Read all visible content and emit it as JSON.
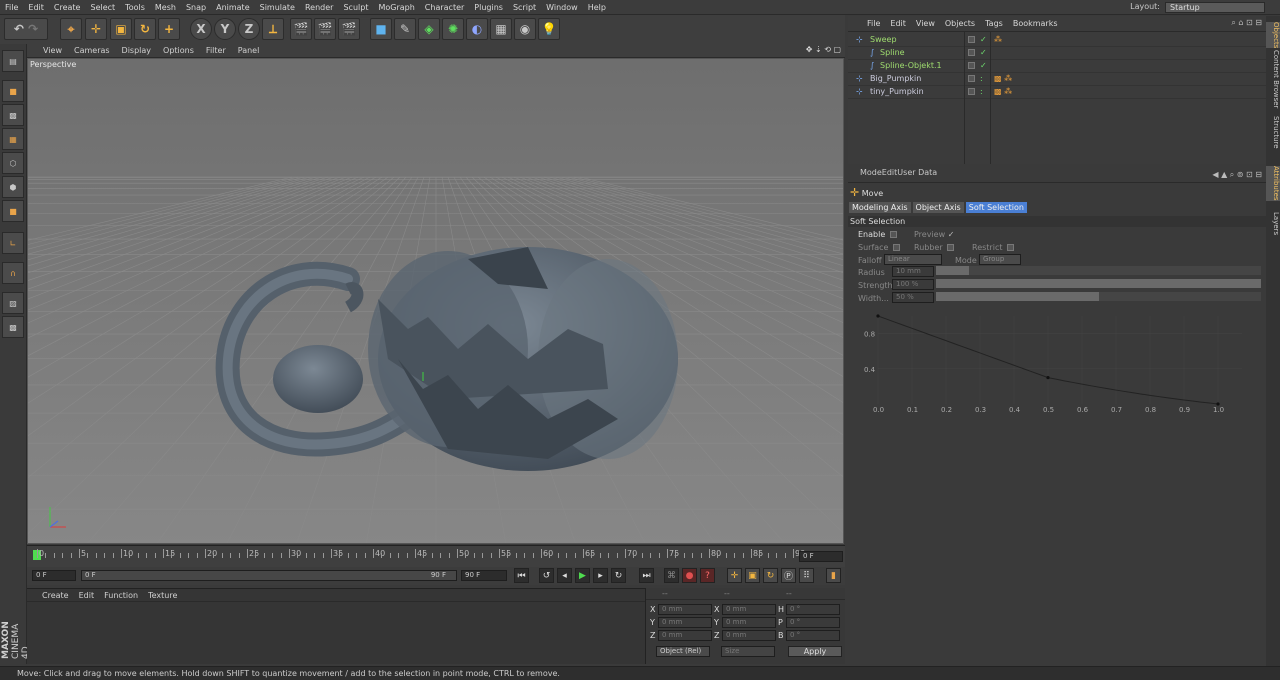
{
  "menubar": {
    "items": [
      "File",
      "Edit",
      "Create",
      "Select",
      "Tools",
      "Mesh",
      "Snap",
      "Animate",
      "Simulate",
      "Render",
      "Sculpt",
      "MoGraph",
      "Character",
      "Plugins",
      "Script",
      "Window",
      "Help"
    ],
    "layout_label": "Layout:",
    "layout_value": "Startup"
  },
  "toolbar": {
    "axis_x": "X",
    "axis_y": "Y",
    "axis_z": "Z"
  },
  "viewport": {
    "menu": [
      "View",
      "Cameras",
      "Display",
      "Options",
      "Filter",
      "Panel"
    ],
    "label": "Perspective"
  },
  "timeline": {
    "ticks": [
      "0",
      "5",
      "10",
      "15",
      "20",
      "25",
      "30",
      "35",
      "40",
      "45",
      "50",
      "55",
      "60",
      "65",
      "70",
      "75",
      "80",
      "85",
      "90"
    ],
    "end_frame": "0 F",
    "current_frame": "0 F",
    "slider_start": "0 F",
    "slider_end": "90 F",
    "max_frame": "90 F"
  },
  "material_manager": {
    "menu": [
      "Create",
      "Edit",
      "Function",
      "Texture"
    ]
  },
  "coordinates": {
    "headers": [
      "--",
      "--",
      "--"
    ],
    "rows": [
      {
        "a": "X",
        "av": "0 mm",
        "b": "X",
        "bv": "0 mm",
        "c": "H",
        "cv": "0 °"
      },
      {
        "a": "Y",
        "av": "0 mm",
        "b": "Y",
        "bv": "0 mm",
        "c": "P",
        "cv": "0 °"
      },
      {
        "a": "Z",
        "av": "0 mm",
        "b": "Z",
        "bv": "0 mm",
        "c": "B",
        "cv": "0 °"
      }
    ],
    "mode": "Object (Rel)",
    "size_mode": "Size",
    "apply": "Apply"
  },
  "objects": {
    "menu": [
      "File",
      "Edit",
      "View",
      "Objects",
      "Tags",
      "Bookmarks"
    ],
    "items": [
      {
        "name": "Sweep",
        "indent": 0
      },
      {
        "name": "Spline",
        "indent": 1
      },
      {
        "name": "Spline-Objekt.1",
        "indent": 1
      },
      {
        "name": "Big_Pumpkin",
        "indent": 0
      },
      {
        "name": "tiny_Pumpkin",
        "indent": 0
      }
    ]
  },
  "attributes": {
    "menu": [
      "Mode",
      "Edit",
      "User Data"
    ],
    "tool_name": "Move",
    "tabs": [
      "Modeling Axis",
      "Object Axis",
      "Soft Selection"
    ],
    "active_tab": "Soft Selection",
    "section": "Soft Selection",
    "enable": "Enable",
    "preview": "Preview",
    "surface": "Surface",
    "rubber": "Rubber",
    "restrict": "Restrict",
    "falloff_label": "Falloff",
    "falloff_value": "Linear",
    "mode_label": "Mode",
    "mode_value": "Group",
    "radius_label": "Radius",
    "radius_value": "10 mm",
    "radius_fraction": 0.1,
    "strength_label": "Strength",
    "strength_value": "100 %",
    "strength_fraction": 1.0,
    "width_label": "Width...",
    "width_value": "50 %",
    "width_fraction": 0.5
  },
  "chart_data": {
    "type": "line",
    "x": [
      0.0,
      0.5,
      1.0
    ],
    "y": [
      1.0,
      0.3,
      0.0
    ],
    "x_ticks": [
      "0.0",
      "0.1",
      "0.2",
      "0.3",
      "0.4",
      "0.5",
      "0.6",
      "0.7",
      "0.8",
      "0.9",
      "1.0"
    ],
    "y_ticks": [
      "0.8",
      "0.4"
    ],
    "xlim": [
      0,
      1
    ],
    "ylim": [
      0,
      1
    ]
  },
  "side_tabs": [
    "Objects",
    "Content Browser",
    "Structure",
    "Attributes",
    "Layers"
  ],
  "branding": {
    "line1": "MAXON",
    "line2": "CINEMA 4D"
  },
  "statusbar": {
    "text": "Move: Click and drag to move elements. Hold down SHIFT to quantize movement / add to the selection in point mode, CTRL to remove."
  },
  "colors": {
    "accent": "#f2a33a",
    "selection": "#3d6fc2",
    "tab_active": "#4a7fd4"
  }
}
